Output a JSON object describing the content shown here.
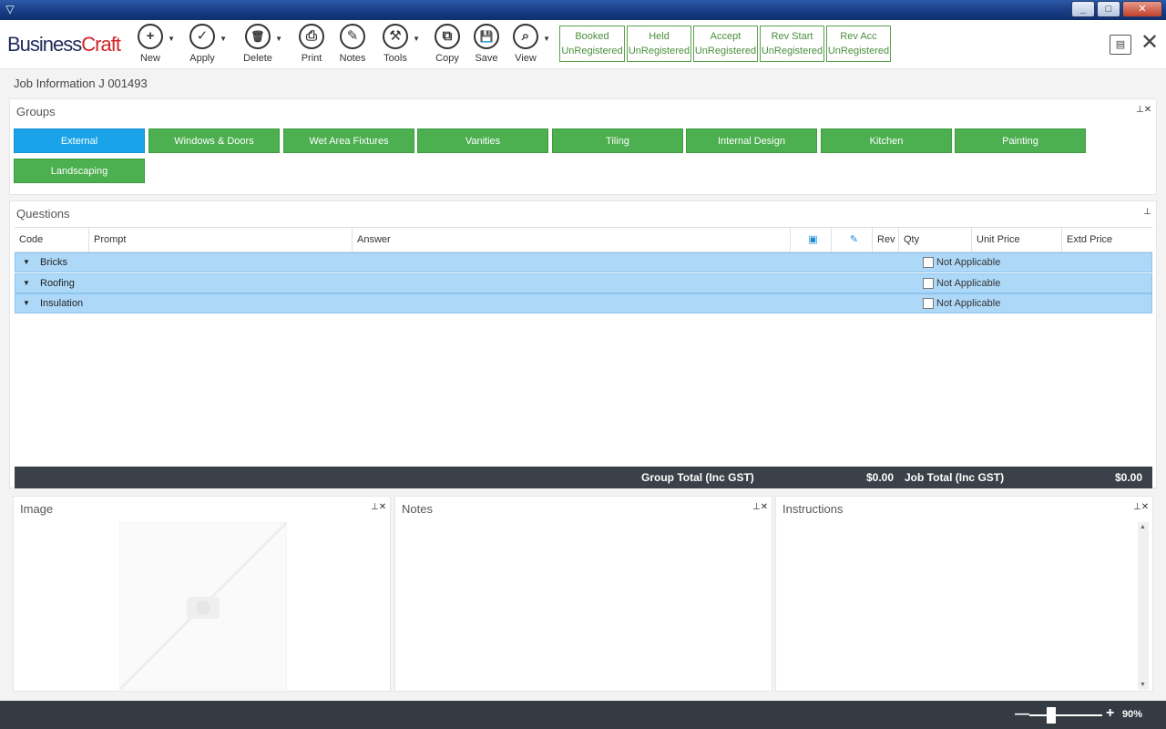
{
  "window": {
    "minimize": "_",
    "maximize": "□",
    "close": "✕"
  },
  "logo": {
    "business": "Business",
    "craft": "Craft"
  },
  "toolbar": {
    "tools": [
      {
        "label": "New",
        "icon": "+"
      },
      {
        "label": "Apply",
        "icon": "✓"
      },
      {
        "label": "Delete",
        "icon": "🗑"
      },
      {
        "label": "Print",
        "icon": "⎙"
      },
      {
        "label": "Notes",
        "icon": "✎"
      },
      {
        "label": "Tools",
        "icon": "⚒"
      },
      {
        "label": "Copy",
        "icon": "⧉"
      },
      {
        "label": "Save",
        "icon": "💾"
      },
      {
        "label": "View",
        "icon": "⌕"
      }
    ],
    "status": [
      {
        "title": "Booked",
        "value": "UnRegistered"
      },
      {
        "title": "Held",
        "value": "UnRegistered"
      },
      {
        "title": "Accept",
        "value": "UnRegistered"
      },
      {
        "title": "Rev Start",
        "value": "UnRegistered"
      },
      {
        "title": "Rev Acc",
        "value": "UnRegistered"
      }
    ],
    "close": "✕"
  },
  "breadcrumb": "Job Information J 001493",
  "groups": {
    "title": "Groups",
    "pin": "⊥✕",
    "items": [
      "External",
      "Windows & Doors",
      "Wet Area Fixtures",
      "Vanities",
      "Tiling",
      "Internal Design",
      "Kitchen",
      "Painting",
      "Landscaping"
    ],
    "active": "External"
  },
  "questions": {
    "title": "Questions",
    "pin": "⊥",
    "columns": {
      "code": "Code",
      "prompt": "Prompt",
      "answer": "Answer",
      "rev": "Rev",
      "qty": "Qty",
      "unit_price": "Unit Price",
      "extd_price": "Extd Price"
    },
    "rows": [
      {
        "name": "Bricks",
        "na": "Not Applicable"
      },
      {
        "name": "Roofing",
        "na": "Not Applicable"
      },
      {
        "name": "Insulation",
        "na": "Not Applicable"
      }
    ],
    "group_total_label": "Group Total (Inc GST)",
    "group_total": "$0.00",
    "job_total_label": "Job Total (Inc GST)",
    "job_total": "$0.00"
  },
  "image_panel": {
    "title": "Image",
    "pin": "⊥✕"
  },
  "notes_panel": {
    "title": "Notes",
    "pin": "⊥✕"
  },
  "instructions_panel": {
    "title": "Instructions",
    "pin": "⊥✕"
  },
  "zoom": {
    "value": "90%",
    "minus": "—",
    "plus": "+"
  }
}
